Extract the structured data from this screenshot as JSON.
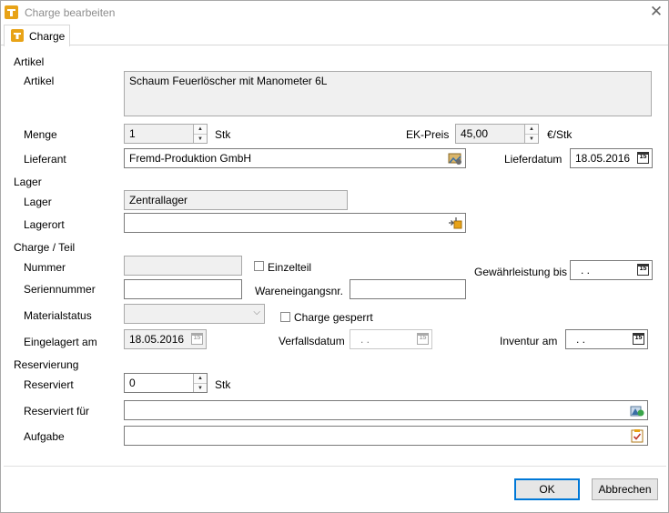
{
  "window": {
    "title": "Charge bearbeiten",
    "close_glyph": "✕"
  },
  "tabs": [
    {
      "label": "Charge",
      "icon": "charge-icon"
    }
  ],
  "artikel": {
    "section": "Artikel",
    "artikel_label": "Artikel",
    "artikel_value": "Schaum Feuerlöscher mit Manometer 6L",
    "menge_label": "Menge",
    "menge_value": "1",
    "menge_unit": "Stk",
    "ekpreis_label": "EK-Preis",
    "ekpreis_value": "45,00",
    "ekpreis_unit": "€/Stk",
    "lieferant_label": "Lieferant",
    "lieferant_value": "Fremd-Produktion GmbH",
    "lieferdatum_label": "Lieferdatum",
    "lieferdatum_value": "18.05.2016"
  },
  "lager": {
    "section": "Lager",
    "lager_label": "Lager",
    "lager_value": "Zentrallager",
    "lagerort_label": "Lagerort",
    "lagerort_value": ""
  },
  "charge": {
    "section": "Charge / Teil",
    "nummer_label": "Nummer",
    "nummer_value": "",
    "einzelteil_label": "Einzelteil",
    "gewaehrleistung_label": "Gewährleistung bis",
    "gewaehrleistung_value": ". .",
    "seriennummer_label": "Seriennummer",
    "seriennummer_value": "",
    "wareneingang_label": "Wareneingangsnr.",
    "wareneingang_value": "",
    "materialstatus_label": "Materialstatus",
    "materialstatus_value": "",
    "gesperrt_label": "Charge gesperrt",
    "eingelagert_label": "Eingelagert am",
    "eingelagert_value": "18.05.2016",
    "verfallsdatum_label": "Verfallsdatum",
    "verfallsdatum_value": ". .",
    "inventur_label": "Inventur am",
    "inventur_value": ". ."
  },
  "reservierung": {
    "section": "Reservierung",
    "reserviert_label": "Reserviert",
    "reserviert_value": "0",
    "reserviert_unit": "Stk",
    "reserviert_fuer_label": "Reserviert für",
    "reserviert_fuer_value": "",
    "aufgabe_label": "Aufgabe",
    "aufgabe_value": ""
  },
  "buttons": {
    "ok": "OK",
    "cancel": "Abbrechen"
  },
  "colors": {
    "accent": "#0078d7",
    "app_icon": "#e8a317"
  }
}
